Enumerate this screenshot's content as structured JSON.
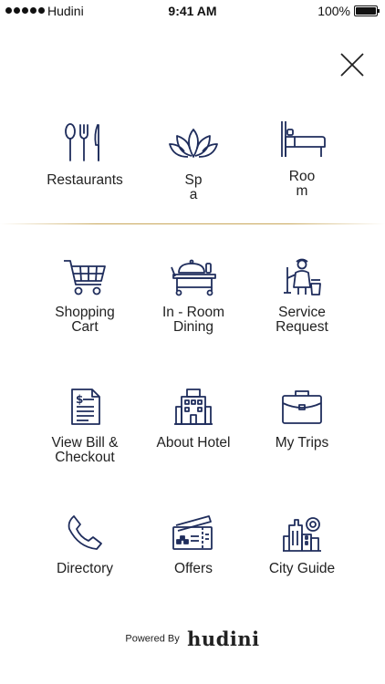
{
  "status_bar": {
    "carrier": "Hudini",
    "time": "9:41 AM",
    "battery": "100%"
  },
  "menu": {
    "items": [
      {
        "label": "Restaurants",
        "icon": "cutlery-icon"
      },
      {
        "label": "Sp\na",
        "icon": "lotus-icon"
      },
      {
        "label": "Roo\nm",
        "icon": "bed-icon"
      },
      {
        "label": "Shopping\nCart",
        "icon": "shopping-cart-icon"
      },
      {
        "label": "In - Room\nDining",
        "icon": "room-service-cart-icon"
      },
      {
        "label": "Service\nRequest",
        "icon": "housekeeping-icon"
      },
      {
        "label": "View Bill &\nCheckout",
        "icon": "bill-icon"
      },
      {
        "label": "About Hotel",
        "icon": "hotel-building-icon"
      },
      {
        "label": "My Trips",
        "icon": "briefcase-icon"
      },
      {
        "label": "Directory",
        "icon": "phone-icon"
      },
      {
        "label": "Offers",
        "icon": "tickets-icon"
      },
      {
        "label": "City Guide",
        "icon": "city-icon"
      }
    ]
  },
  "footer": {
    "powered_by": "Powered By",
    "brand": "hudini"
  },
  "colors": {
    "icon": "#1f2d5c",
    "divider": "#c9a85c",
    "text": "#222222"
  }
}
